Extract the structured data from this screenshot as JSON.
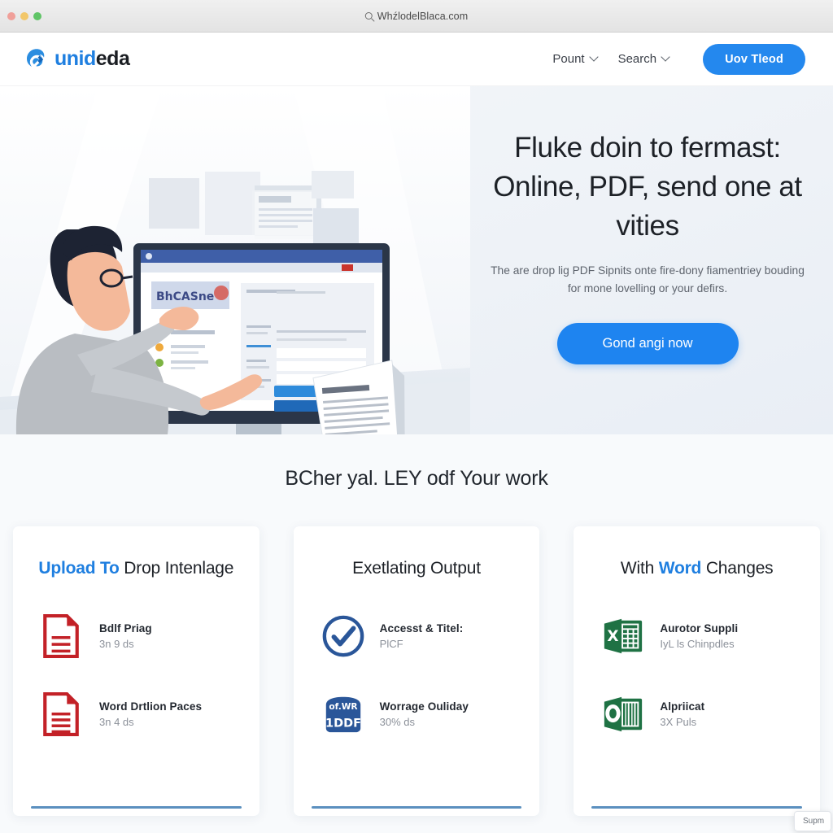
{
  "browser": {
    "url": "WhźlodelBlaca.com",
    "search_icon": "search-icon",
    "traffic_lights": [
      "close",
      "minimize",
      "zoom"
    ]
  },
  "header": {
    "logo_icon": "unideda-swirl-logo-icon",
    "logo_text_primary": "unid",
    "logo_text_secondary": "eda",
    "nav": [
      {
        "label": "Pount",
        "caret": "chevron-down-icon"
      },
      {
        "label": "Search",
        "caret": "chevron-down-icon"
      }
    ],
    "cta_label": "Uov Tleod"
  },
  "hero": {
    "title": "Fluke doin to fermast: Online, PDF, send one at vities",
    "subtitle": "The are drop lig PDF Sipnits onte fire-dony fiamentriey bouding for mone lovelling or your defirs.",
    "cta_label": "Gond angi now",
    "illustration": {
      "name": "man-pointing-at-monitor-illustration",
      "monitor_banner_text": "BhCASne"
    }
  },
  "features": {
    "heading": "BCher yal. LEY odf Your work",
    "cards": [
      {
        "title_highlight": "Upload To",
        "title_rest": " Drop Intenlage",
        "rows": [
          {
            "icon": "pdf-document-icon",
            "primary": "Bdlf Priag",
            "secondary": "3n 9 ds"
          },
          {
            "icon": "pdf-document-icon",
            "primary": "Word Drtlion Paces",
            "secondary": "3n 4 ds"
          }
        ]
      },
      {
        "title_highlight": "",
        "title_rest": "Exetlating Output",
        "rows": [
          {
            "icon": "check-circle-icon",
            "primary": "Accesst & Titel:",
            "secondary": "PlCF"
          },
          {
            "icon": "word-badge-icon",
            "primary": "Worrage Ouliday",
            "secondary": "30% ds"
          }
        ]
      },
      {
        "title_prefix": "With ",
        "title_highlight": "Word",
        "title_rest": " Changes",
        "rows": [
          {
            "icon": "excel-file-icon",
            "primary": "Aurotor Suppli",
            "secondary": "IyL ls Chinpdles"
          },
          {
            "icon": "office-file-icon",
            "primary": "Alpriicat",
            "secondary": "3X Puls"
          }
        ]
      }
    ]
  },
  "floating_tooltip": {
    "text": "Supm"
  },
  "colors": {
    "accent_blue": "#2488ee",
    "cta_blue": "#1e84f0",
    "logo_blue": "#1f7fe0",
    "pdf_red": "#c32127",
    "excel_green": "#1f7244",
    "word_blue": "#2a5699",
    "underline": "#5b90bf",
    "text_dark": "#1d2127",
    "text_muted": "#8b9099"
  }
}
